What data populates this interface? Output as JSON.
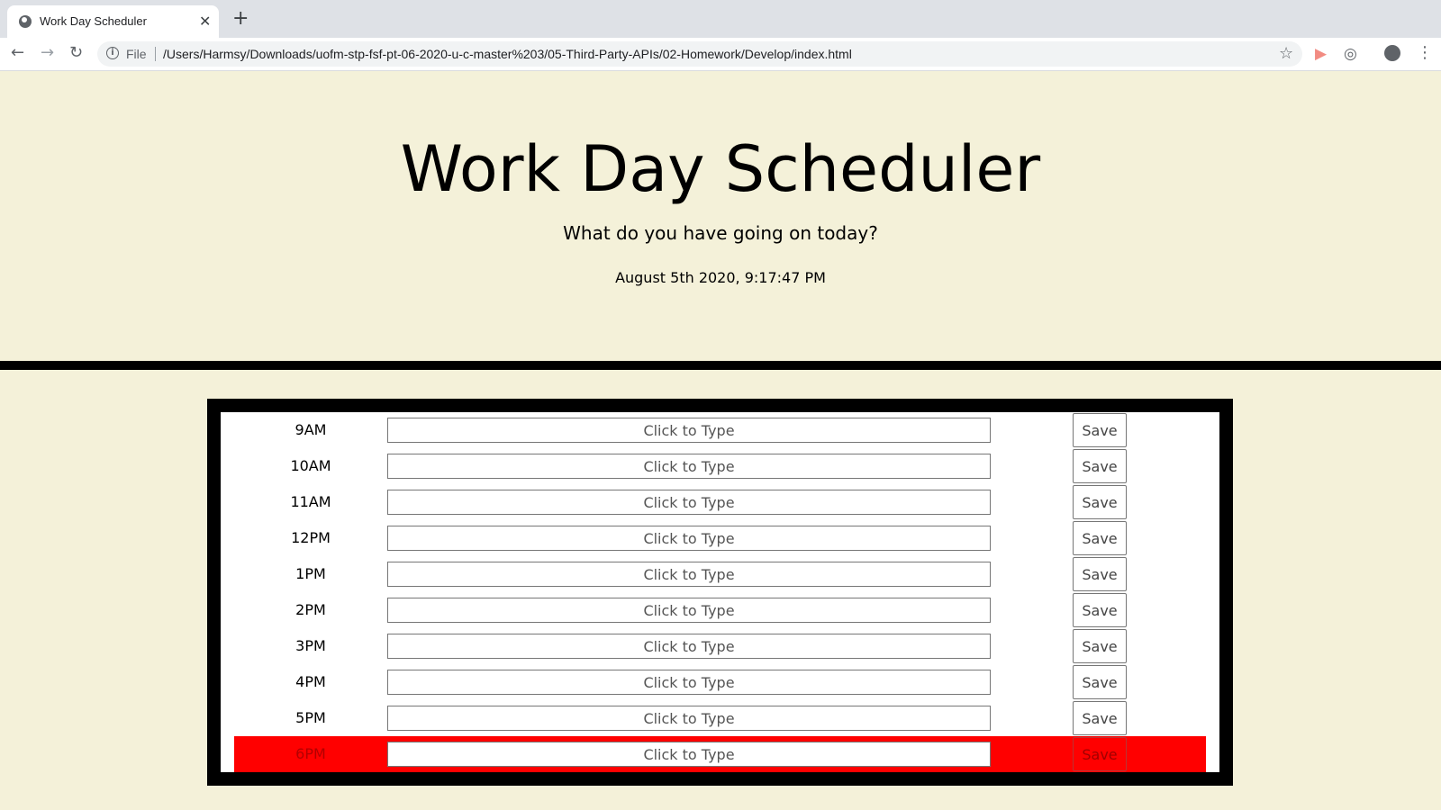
{
  "browser": {
    "tab_title": "Work Day Scheduler",
    "tab_close": "✕",
    "new_tab": "+",
    "file_label": "File",
    "url": "/Users/Harmsy/Downloads/uofm-stp-fsf-pt-06-2020-u-c-master%203/05-Third-Party-APIs/02-Homework/Develop/index.html",
    "icons": {
      "back": "←",
      "forward": "→",
      "reload": "↻",
      "info": "i",
      "star": "☆",
      "menu": "⋮"
    }
  },
  "header": {
    "title": "Work Day Scheduler",
    "subtitle": "What do you have going on today?",
    "current_day": "August 5th 2020, 9:17:47 PM"
  },
  "colors": {
    "page_background": "#f4f1d9",
    "present_row": "#ff0000",
    "frame": "#000000"
  },
  "schedule": {
    "placeholder": "Click to Type",
    "save_label": "Save",
    "hours": [
      {
        "hour": "9AM",
        "value": "",
        "state": "normal"
      },
      {
        "hour": "10AM",
        "value": "",
        "state": "normal"
      },
      {
        "hour": "11AM",
        "value": "",
        "state": "normal"
      },
      {
        "hour": "12PM",
        "value": "",
        "state": "normal"
      },
      {
        "hour": "1PM",
        "value": "",
        "state": "normal"
      },
      {
        "hour": "2PM",
        "value": "",
        "state": "normal"
      },
      {
        "hour": "3PM",
        "value": "",
        "state": "normal"
      },
      {
        "hour": "4PM",
        "value": "",
        "state": "normal"
      },
      {
        "hour": "5PM",
        "value": "",
        "state": "normal"
      },
      {
        "hour": "6PM",
        "value": "",
        "state": "present"
      }
    ]
  }
}
